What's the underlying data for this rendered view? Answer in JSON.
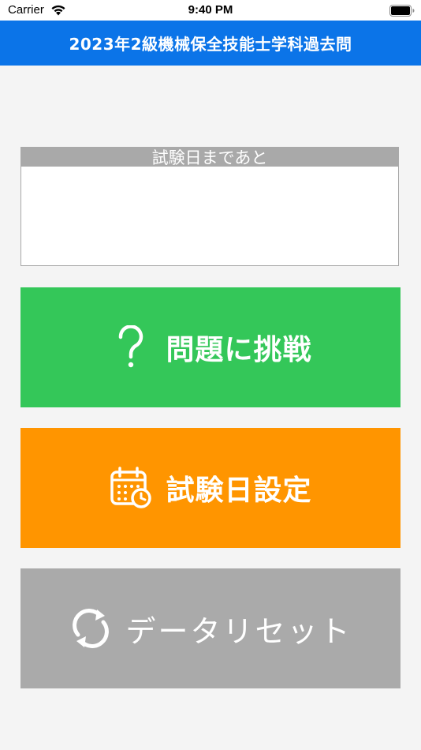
{
  "status_bar": {
    "carrier": "Carrier",
    "time": "9:40 PM"
  },
  "nav": {
    "title": "2023年2級機械保全技能士学科過去問"
  },
  "countdown": {
    "header": "試験日まであと",
    "value": ""
  },
  "buttons": {
    "challenge": {
      "label": "問題に挑戦",
      "icon": "question-mark-icon",
      "color": "#34c759"
    },
    "exam_date": {
      "label": "試験日設定",
      "icon": "calendar-clock-icon",
      "color": "#ff9500"
    },
    "reset": {
      "label": "データリセット",
      "icon": "refresh-icon",
      "color": "#aaaaaa"
    }
  },
  "colors": {
    "nav_bar": "#0b74e8",
    "background": "#f4f4f4"
  }
}
